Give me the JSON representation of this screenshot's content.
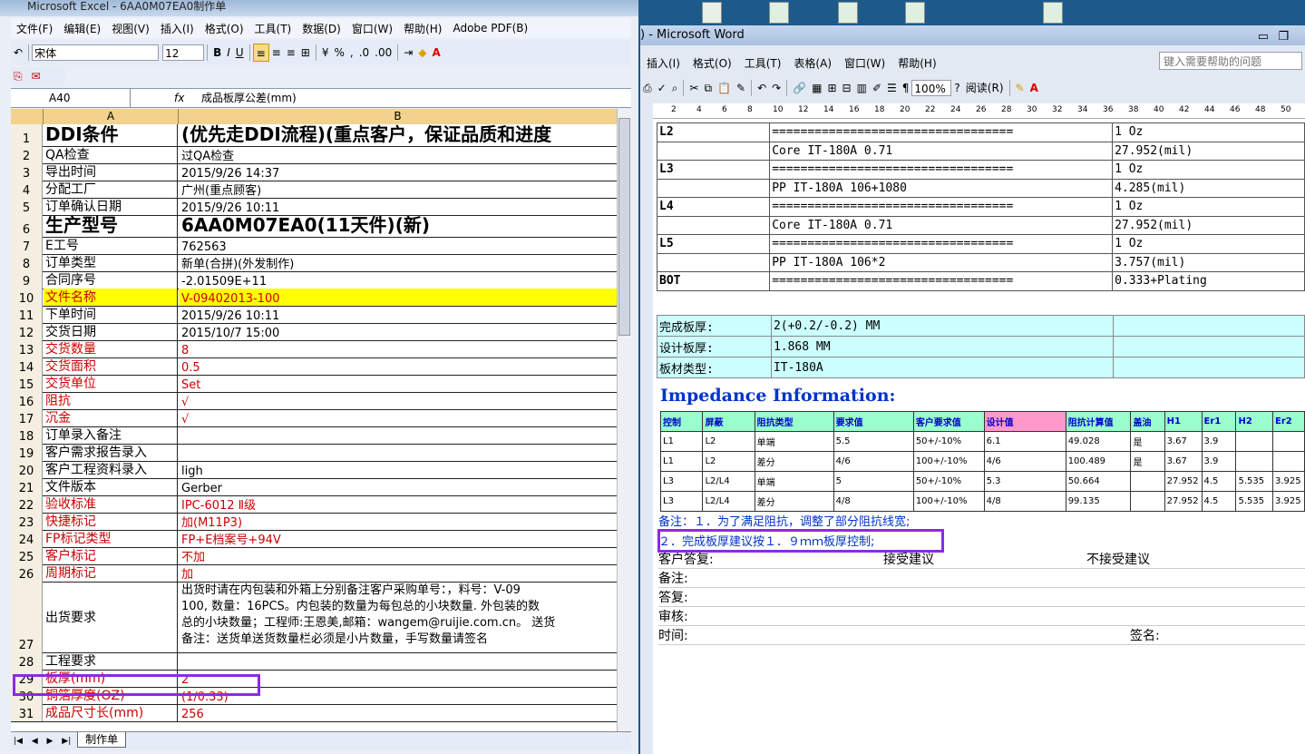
{
  "excel": {
    "title": "Microsoft Excel - 6AA0M07EA0制作单",
    "menu": [
      "文件(F)",
      "编辑(E)",
      "视图(V)",
      "插入(I)",
      "格式(O)",
      "工具(T)",
      "数据(D)",
      "窗口(W)",
      "帮助(H)",
      "Adobe PDF(B)"
    ],
    "font_name": "宋体",
    "font_size": "12",
    "name_box": "A40",
    "fx_label": "fx",
    "formula_value": "成品板厚公差(mm)",
    "col_a": "A",
    "col_b": "B",
    "rows": [
      {
        "n": "1",
        "a": "DDI条件",
        "b": "(优先走DDI流程)(重点客户，保证品质和进度"
      },
      {
        "n": "2",
        "a": "QA检查",
        "b": "过QA检查"
      },
      {
        "n": "3",
        "a": "导出时间",
        "b": "2015/9/26 14:37"
      },
      {
        "n": "4",
        "a": "分配工厂",
        "b": "广州(重点顾客)"
      },
      {
        "n": "5",
        "a": "订单确认日期",
        "b": "2015/9/26 10:11"
      },
      {
        "n": "6",
        "a": "生产型号",
        "b": "6AA0M07EA0(11天件)(新)"
      },
      {
        "n": "7",
        "a": "E工号",
        "b": "762563"
      },
      {
        "n": "8",
        "a": "订单类型",
        "b": "新单(合拼)(外发制作)"
      },
      {
        "n": "9",
        "a": "合同序号",
        "b": "-2.01509E+11"
      },
      {
        "n": "10",
        "a": "文件名称",
        "b": "V-09402013-100"
      },
      {
        "n": "11",
        "a": "下单时间",
        "b": "2015/9/26 10:11"
      },
      {
        "n": "12",
        "a": "交货日期",
        "b": "2015/10/7 15:00"
      },
      {
        "n": "13",
        "a": "交货数量",
        "b": "8"
      },
      {
        "n": "14",
        "a": "交货面积",
        "b": "0.5"
      },
      {
        "n": "15",
        "a": "交货单位",
        "b": "Set"
      },
      {
        "n": "16",
        "a": "阻抗",
        "b": "√"
      },
      {
        "n": "17",
        "a": "沉金",
        "b": "√"
      },
      {
        "n": "18",
        "a": "订单录入备注",
        "b": ""
      },
      {
        "n": "19",
        "a": "客户需求报告录入",
        "b": ""
      },
      {
        "n": "20",
        "a": "客户工程资料录入",
        "b": "ligh"
      },
      {
        "n": "21",
        "a": "文件版本",
        "b": "Gerber"
      },
      {
        "n": "22",
        "a": "验收标准",
        "b": "IPC-6012 Ⅱ级"
      },
      {
        "n": "23",
        "a": "快捷标记",
        "b": "加(M11P3)"
      },
      {
        "n": "24",
        "a": "FP标记类型",
        "b": "FP+E档案号+94V"
      },
      {
        "n": "25",
        "a": "客户标记",
        "b": "不加"
      },
      {
        "n": "26",
        "a": "周期标记",
        "b": "加"
      },
      {
        "n": "27",
        "a": "出货要求",
        "b_lines": [
          "出货时请在内包装和外箱上分别备注客户采购单号：，料号：V-09",
          "100, 数量：16PCS。内包装的数量为每包总的小块数量. 外包装的数",
          "总的小块数量；工程师:王恩美,邮箱：wangem@ruijie.com.cn。 送货",
          "备注：送货单送货数量栏必须是小片数量，手写数量请签名"
        ]
      },
      {
        "n": "28",
        "a": "工程要求",
        "b": ""
      },
      {
        "n": "29",
        "a": "板厚(mm)",
        "b": "2"
      },
      {
        "n": "30",
        "a": "铜箔厚度(OZ)",
        "b": "(1/0.33)"
      },
      {
        "n": "31",
        "a": "成品尺寸长(mm)",
        "b": "256"
      }
    ],
    "sheet_tab": "制作单"
  },
  "word": {
    "title": ") - Microsoft Word",
    "menu": [
      "插入(I)",
      "格式(O)",
      "工具(T)",
      "表格(A)",
      "窗口(W)",
      "帮助(H)"
    ],
    "help_placeholder": "键入需要帮助的问题",
    "zoom": "100%",
    "read_mode": "阅读(R)",
    "ruler_ticks": [
      "2",
      "4",
      "6",
      "8",
      "10",
      "12",
      "14",
      "16",
      "18",
      "20",
      "22",
      "24",
      "26",
      "28",
      "30",
      "32",
      "34",
      "36",
      "38",
      "40",
      "42",
      "44",
      "46",
      "48",
      "50"
    ],
    "stackup": [
      {
        "layer": "L2",
        "desc": "==================================",
        "val": "1 Oz"
      },
      {
        "layer": "",
        "desc": "Core     IT-180A    0.71",
        "val": "27.952(mil)"
      },
      {
        "layer": "L3",
        "desc": "==================================",
        "val": "1 Oz"
      },
      {
        "layer": "",
        "desc": "PP     IT-180A    106+1080",
        "val": "4.285(mil)"
      },
      {
        "layer": "L4",
        "desc": "==================================",
        "val": "1 Oz"
      },
      {
        "layer": "",
        "desc": "Core     IT-180A    0.71",
        "val": "27.952(mil)"
      },
      {
        "layer": "L5",
        "desc": "==================================",
        "val": "1 Oz"
      },
      {
        "layer": "",
        "desc": "PP     IT-180A    106*2",
        "val": "3.757(mil)"
      },
      {
        "layer": "BOT",
        "desc": "==================================",
        "val": "0.333+Plating"
      }
    ],
    "thickness": [
      {
        "label": "完成板厚:",
        "value": "2(+0.2/-0.2) MM"
      },
      {
        "label": "设计板厚:",
        "value": "1.868 MM"
      },
      {
        "label": "板材类型:",
        "value": "IT-180A"
      }
    ],
    "impedance_title": "Impedance Information:",
    "imp_headers": [
      "控制",
      "屏蔽",
      "阻抗类型",
      "要求值",
      "客户要求值",
      "设计值",
      "阻抗计算值",
      "盖油",
      "H1",
      "Er1",
      "H2",
      "Er2"
    ],
    "imp_rows": [
      [
        "L1",
        "L2",
        "单端",
        "5.5",
        "50+/-10%",
        "6.1",
        "49.028",
        "是",
        "3.67",
        "3.9",
        "",
        ""
      ],
      [
        "L1",
        "L2",
        "差分",
        "4/6",
        "100+/-10%",
        "4/6",
        "100.489",
        "是",
        "3.67",
        "3.9",
        "",
        ""
      ],
      [
        "L3",
        "L2/L4",
        "单端",
        "5",
        "50+/-10%",
        "5.3",
        "50.664",
        "",
        "27.952",
        "4.5",
        "5.535",
        "3.925"
      ],
      [
        "L3",
        "L2/L4",
        "差分",
        "4/8",
        "100+/-10%",
        "4/8",
        "99.135",
        "",
        "27.952",
        "4.5",
        "5.535",
        "3.925"
      ]
    ],
    "note1": "备注：１．为了满足阻抗，调整了部分阻抗线宽;",
    "note2": "２．完成板厚建议按１．９ｍｍ板厚控制;",
    "reply_label": "客户答复:",
    "accept": "接受建议",
    "reject": "不接受建议",
    "remark_label": "备注:",
    "answer_label": "答复:",
    "review_label": "审核:",
    "time_label": "时间:",
    "sign_label": "签名:"
  },
  "colors": {
    "highlight_box": "#8a2be2",
    "header_cyan": "#ccffff",
    "impedance_blue": "#0033cc"
  }
}
